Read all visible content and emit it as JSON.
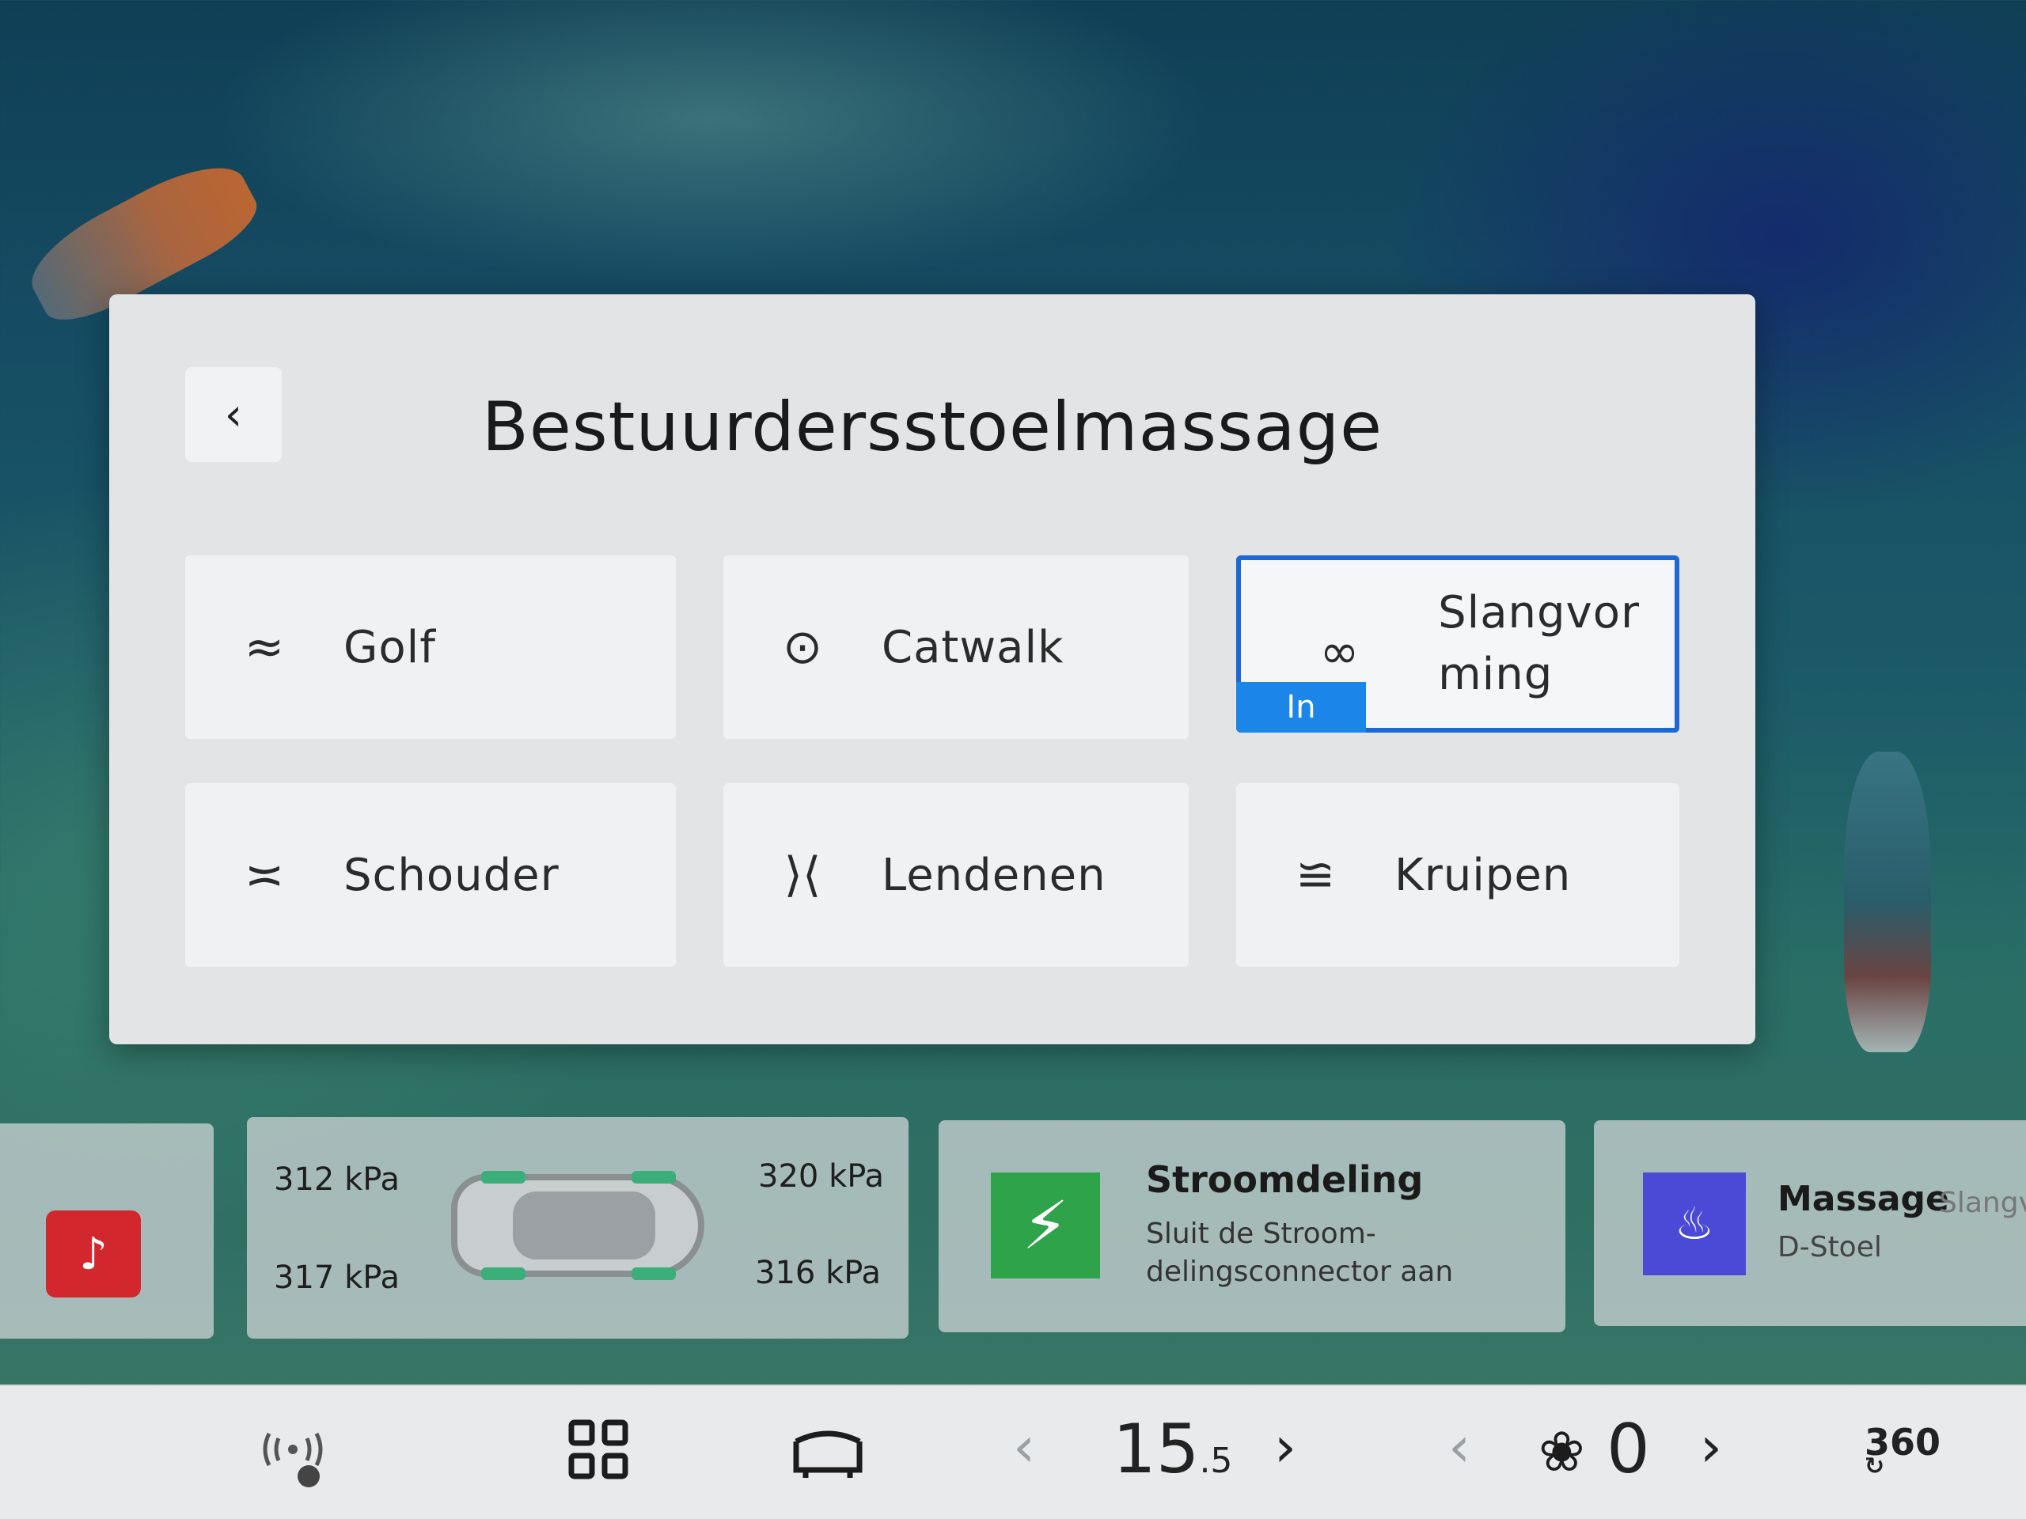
{
  "panel": {
    "back_icon": "chevron-left-icon",
    "title": "Bestuurdersstoelmassage",
    "modes": [
      {
        "label": "Golf",
        "icon": "wave-icon",
        "glyph": "≈"
      },
      {
        "label": "Catwalk",
        "icon": "target-icon",
        "glyph": "⊙"
      },
      {
        "label": "Slangvorming",
        "icon": "infinity-icon",
        "glyph": "∞",
        "active": true,
        "badge": "In"
      },
      {
        "label": "Schouder",
        "icon": "curve-down-icon",
        "glyph": "≍"
      },
      {
        "label": "Lendenen",
        "icon": "brackets-icon",
        "glyph": "⟩⟨"
      },
      {
        "label": "Kruipen",
        "icon": "crawl-icon",
        "glyph": "≌"
      }
    ]
  },
  "widgets": {
    "tire_pressure": {
      "front_left": "312 kPa",
      "front_right": "320 kPa",
      "rear_left": "317 kPa",
      "rear_right": "316 kPa"
    },
    "power": {
      "title": "Stroomdeling",
      "subtitle": "Sluit de Stroom-\ndelingsconnector aan"
    },
    "massage": {
      "title": "Massage",
      "tag": "Slangv",
      "subtitle": "D-Stoel"
    }
  },
  "dock": {
    "temperature_main": "15",
    "temperature_fraction": ".5",
    "fan_level": "0",
    "view_label": "360"
  },
  "colors": {
    "active_border": "#1e67d6",
    "badge": "#1b86e8",
    "usb": "#d2272d",
    "power": "#2fa34a",
    "massage": "#4a4ad6"
  }
}
